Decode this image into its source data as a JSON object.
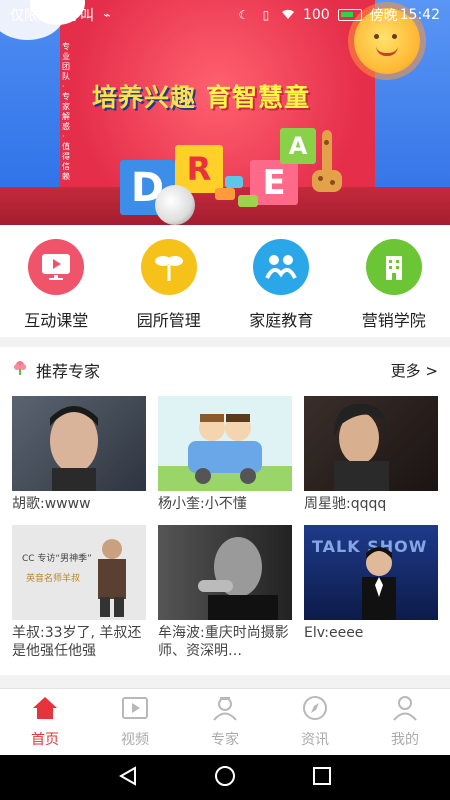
{
  "status_bar": {
    "carrier": "仅限紧急呼叫",
    "battery": "100",
    "time": "15:42",
    "time_prefix": "傍晚"
  },
  "banner": {
    "vertical_text": "专业团队 · 专家解惑 · 值得信赖",
    "slogan_1": "培养兴趣",
    "slogan_2": "育智慧童",
    "blocks": [
      "D",
      "R",
      "E",
      "A"
    ]
  },
  "categories": [
    {
      "label": "互动课堂",
      "icon": "screen-play-icon",
      "color": "#f0546a"
    },
    {
      "label": "园所管理",
      "icon": "sprout-icon",
      "color": "#f6c21a"
    },
    {
      "label": "家庭教育",
      "icon": "family-icon",
      "color": "#2aa7e8"
    },
    {
      "label": "营销学院",
      "icon": "building-icon",
      "color": "#6cc534"
    }
  ],
  "experts": {
    "title": "推荐专家",
    "more": "更多 >",
    "items": [
      {
        "caption": "胡歌:wwww"
      },
      {
        "caption": "杨小奎:小不懂"
      },
      {
        "caption": "周星驰:qqqq"
      },
      {
        "caption": "羊叔:33岁了, 羊叔还是他强任他强",
        "thumb_text_1": "CC 专访“男神季”",
        "thumb_text_2": "英音名师羊叔"
      },
      {
        "caption": "牟海波:重庆时尚摄影师、资深明…"
      },
      {
        "caption": "Elv:eeee",
        "thumb_text_1": "TALK SHOW"
      }
    ]
  },
  "bottom_nav": [
    {
      "label": "首页",
      "icon": "home-icon",
      "active": true
    },
    {
      "label": "视频",
      "icon": "video-icon",
      "active": false
    },
    {
      "label": "专家",
      "icon": "expert-icon",
      "active": false
    },
    {
      "label": "资讯",
      "icon": "compass-icon",
      "active": false
    },
    {
      "label": "我的",
      "icon": "profile-icon",
      "active": false
    }
  ],
  "colors": {
    "accent": "#e8323c",
    "inactive": "#aaaaaa"
  }
}
